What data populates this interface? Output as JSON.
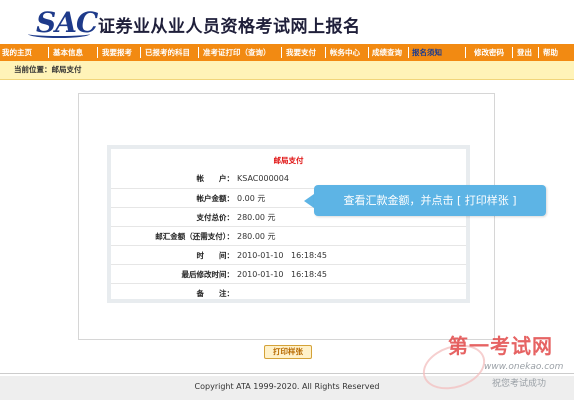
{
  "header": {
    "logo": "SAC",
    "title": "证券业从业人员资格考试网上报名"
  },
  "nav": {
    "left": [
      "我的主页",
      "基本信息",
      "我要报考",
      "已报考的科目",
      "准考证打印（查询）",
      "我要支付",
      "帐务中心",
      "成绩查询",
      "报名须知"
    ],
    "right": [
      "修改密码",
      "登出",
      "帮助"
    ],
    "active": "报名须知"
  },
  "breadcrumb": "当前位置：邮局支付",
  "payment": {
    "title": "邮局支付",
    "rows": [
      {
        "label": "帐　　户：",
        "value": "KSAC000004",
        "time": ""
      },
      {
        "label": "帐户金额：",
        "value": "0.00 元",
        "time": ""
      },
      {
        "label": "支付总价：",
        "value": "280.00 元",
        "time": ""
      },
      {
        "label": "邮汇金额（还需支付）：",
        "value": "280.00 元",
        "time": ""
      },
      {
        "label": "时　　间：",
        "value": "2010-01-10",
        "time": "16:18:45"
      },
      {
        "label": "最后修改时间：",
        "value": "2010-01-10",
        "time": "16:18:45"
      },
      {
        "label": "备　　注：",
        "value": "",
        "time": ""
      }
    ]
  },
  "tooltip": "查看汇款金额，并点击 [ 打印样张 ]",
  "print_button": "打印样张",
  "footer": "Copyright ATA 1999-2020. All Rights Reserved",
  "watermark": {
    "title": "第一考试网",
    "url": "www.onekao.com",
    "slogan": "祝您考试成功"
  },
  "colors": {
    "nav_bg": "#f28a12",
    "breadcrumb_bg": "#fff3b8",
    "tooltip_bg": "#5db4e5",
    "title_red": "#e01010",
    "logo_blue": "#1e3a8a"
  }
}
